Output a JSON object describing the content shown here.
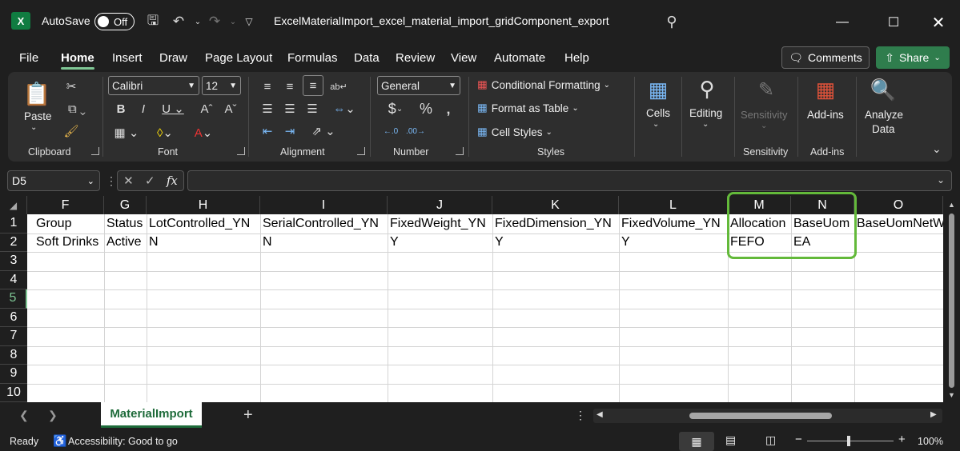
{
  "app": {
    "logo_letter": "X",
    "autosave_label": "AutoSave",
    "autosave_state": "Off",
    "title": "ExcelMaterialImport_excel_material_import_gridComponent_export"
  },
  "menu": [
    "File",
    "Home",
    "Insert",
    "Draw",
    "Page Layout",
    "Formulas",
    "Data",
    "Review",
    "View",
    "Automate",
    "Help"
  ],
  "header_buttons": {
    "comments": "Comments",
    "share": "Share"
  },
  "ribbon": {
    "clipboard": {
      "paste": "Paste",
      "label": "Clipboard"
    },
    "font": {
      "name": "Calibri",
      "size": "12",
      "label": "Font"
    },
    "alignment": {
      "label": "Alignment"
    },
    "number": {
      "format": "General",
      "label": "Number"
    },
    "styles": {
      "conditional": "Conditional Formatting",
      "format_table": "Format as Table",
      "cell_styles": "Cell Styles",
      "label": "Styles"
    },
    "cells": {
      "label": "Cells"
    },
    "editing": {
      "label": "Editing"
    },
    "sensitivity": {
      "button": "Sensitivity",
      "label": "Sensitivity"
    },
    "addins": {
      "button": "Add-ins",
      "label": "Add-ins"
    },
    "analyze": {
      "line1": "Analyze",
      "line2": "Data"
    }
  },
  "formula_bar": {
    "name_box": "D5",
    "fx": "fx",
    "formula": ""
  },
  "grid": {
    "columns": [
      "F",
      "G",
      "H",
      "I",
      "J",
      "K",
      "L",
      "M",
      "N",
      "O"
    ],
    "rows": [
      "1",
      "2",
      "3",
      "4",
      "5",
      "6",
      "7",
      "8",
      "9",
      "10"
    ],
    "row1": [
      "Group",
      "Status",
      "LotControlled_YN",
      "SerialControlled_YN",
      "FixedWeight_YN",
      "FixedDimension_YN",
      "FixedVolume_YN",
      "Allocation",
      "BaseUom",
      "BaseUomNetW"
    ],
    "row2": [
      "Soft Drinks",
      "Active",
      "N",
      "N",
      "Y",
      "Y",
      "Y",
      "FEFO",
      "EA",
      ""
    ]
  },
  "sheet": {
    "tab": "MaterialImport",
    "add": "+"
  },
  "status": {
    "ready": "Ready",
    "accessibility": "Accessibility: Good to go",
    "zoom": "100%"
  }
}
